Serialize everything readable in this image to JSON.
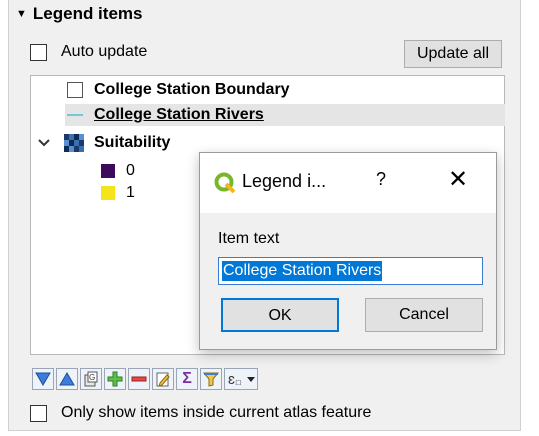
{
  "section": {
    "title": "Legend items"
  },
  "auto_update": {
    "label": "Auto update",
    "checked": false
  },
  "update_all": {
    "label": "Update all"
  },
  "tree": {
    "items": [
      {
        "label": "College Station Boundary",
        "icon": "empty-square"
      },
      {
        "label": "College Station Rivers",
        "icon": "line-symbol",
        "color": "#72c7d9",
        "selected": true
      },
      {
        "label": "Suitability",
        "icon": "raster-icon",
        "expanded": true
      },
      {
        "label": "0",
        "icon": "swatch",
        "color": "#3d0a5a"
      },
      {
        "label": "1",
        "icon": "swatch",
        "color": "#f5e41a"
      }
    ]
  },
  "toolbar": {
    "buttons": [
      "move-down-icon",
      "move-up-icon",
      "group-icon",
      "add-icon",
      "remove-icon",
      "edit-icon",
      "sum-icon",
      "filter-icon",
      "expression-icon"
    ]
  },
  "atlas_filter": {
    "label": "Only show items inside current atlas feature",
    "checked": false
  },
  "dialog": {
    "title": "Legend i...",
    "help": "?",
    "close": "✕",
    "field_label": "Item text",
    "field_value": "College Station Rivers",
    "ok": "OK",
    "cancel": "Cancel"
  }
}
